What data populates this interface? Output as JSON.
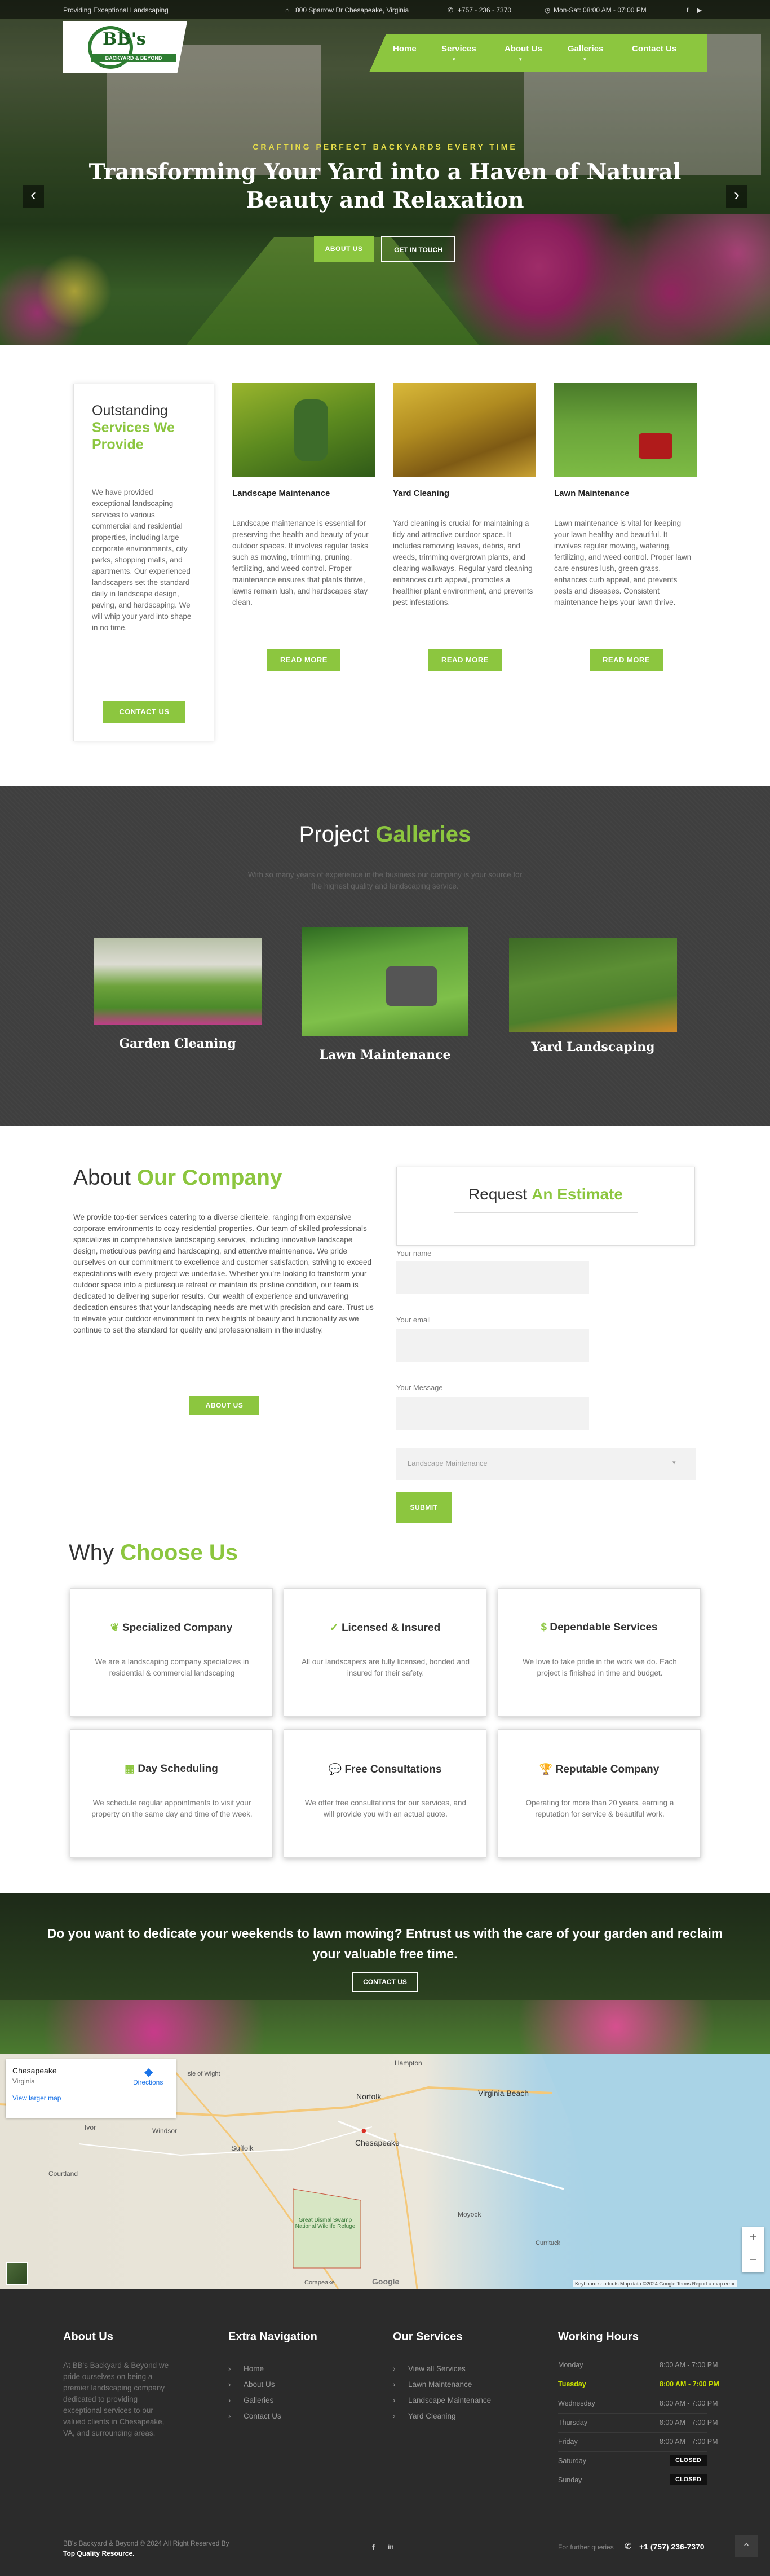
{
  "topbar": {
    "tagline": "Providing Exceptional Landscaping",
    "location": "800 Sparrow Dr Chesapeake, Virginia",
    "phone": "+757 - 236 - 7370",
    "hours": "Mon-Sat: 08:00 AM - 07:00 PM"
  },
  "logo": {
    "text": "BB's",
    "sub": "BACKYARD & BEYOND"
  },
  "nav": [
    "Home",
    "Services",
    "About Us",
    "Galleries",
    "Contact Us"
  ],
  "hero": {
    "kicker": "CRAFTING PERFECT BACKYARDS EVERY TIME",
    "title": "Transforming Your Yard into a Haven of Natural Beauty and Relaxation",
    "btn_about": "ABOUT US",
    "btn_touch": "GET IN TOUCH",
    "prev": "‹",
    "next": "›"
  },
  "services_intro": {
    "title_a": "Outstanding",
    "title_b": "Services We Provide",
    "text": "We have provided exceptional landscaping services to various commercial and residential properties, including large corporate environments, city parks, shopping malls, and apartments. Our experienced landscapers set the standard daily in landscape design, paving, and hardscaping. We will whip your yard into shape in no time.",
    "button": "CONTACT US"
  },
  "services": [
    {
      "title": "Landscape Maintenance",
      "text": "Landscape maintenance is essential for preserving the health and beauty of your outdoor spaces. It involves regular tasks such as mowing, trimming, pruning, fertilizing, and weed control. Proper maintenance ensures that plants thrive, lawns remain lush, and hardscapes stay clean.",
      "button": "READ MORE"
    },
    {
      "title": "Yard Cleaning",
      "text": "Yard cleaning is crucial for maintaining a tidy and attractive outdoor space. It includes removing leaves, debris, and weeds, trimming overgrown plants, and clearing walkways. Regular yard cleaning enhances curb appeal, promotes a healthier plant environment, and prevents pest infestations.",
      "button": "READ MORE"
    },
    {
      "title": "Lawn Maintenance",
      "text": "Lawn maintenance is vital for keeping your lawn healthy and beautiful. It involves regular mowing, watering, fertilizing, and weed control. Proper lawn care ensures lush, green grass, enhances curb appeal, and prevents pests and diseases. Consistent maintenance helps your lawn thrive.",
      "button": "READ MORE"
    }
  ],
  "galleries": {
    "title_a": "Project",
    "title_b": "Galleries",
    "subtitle": "With so many years of experience in the business our company is your source for the highest quality and landscaping service.",
    "items": [
      "Garden Cleaning",
      "Lawn Maintenance",
      "Yard Landscaping"
    ]
  },
  "about": {
    "title_a": "About",
    "title_b": "Our Company",
    "text": "We provide top-tier services catering to a diverse clientele, ranging from expansive corporate environments to cozy residential properties. Our team of skilled professionals specializes in comprehensive landscaping services, including innovative landscape design, meticulous paving and hardscaping, and attentive maintenance. We pride ourselves on our commitment to excellence and customer satisfaction, striving to exceed expectations with every project we undertake. Whether you're looking to transform your outdoor space into a picturesque retreat or maintain its pristine condition, our team is dedicated to delivering superior results. Our wealth of experience and unwavering dedication ensures that your landscaping needs are met with precision and care. Trust us to elevate your outdoor environment to new heights of beauty and functionality as we continue to set the standard for quality and professionalism in the industry.",
    "button": "ABOUT US"
  },
  "estimate": {
    "title_a": "Request",
    "title_b": "An Estimate",
    "name_label": "Your name",
    "email_label": "Your email",
    "message_label": "Your Message",
    "select_value": "Landscape Maintenance",
    "submit": "SUBMIT"
  },
  "why": {
    "title_a": "Why",
    "title_b": "Choose Us",
    "items": [
      {
        "icon": "leaf-icon",
        "glyph": "❦",
        "title": "Specialized Company",
        "text": "We are a landscaping company specializes in residential & commercial landscaping"
      },
      {
        "icon": "check-circle-icon",
        "glyph": "✓",
        "title": "Licensed & Insured",
        "text": "All our landscapers are fully licensed, bonded and insured for their safety."
      },
      {
        "icon": "money-bag-icon",
        "glyph": "$",
        "title": "Dependable Services",
        "text": "We love to take pride in the work we do. Each project is finished in time and budget."
      },
      {
        "icon": "calendar-icon",
        "glyph": "▦",
        "title": "Day Scheduling",
        "text": "We schedule regular appointments to visit your property on the same day and time of the week."
      },
      {
        "icon": "chat-icon",
        "glyph": "💬",
        "title": "Free Consultations",
        "text": "We offer free consultations for our services, and will provide you with an actual quote."
      },
      {
        "icon": "trophy-icon",
        "glyph": "🏆",
        "title": "Reputable Company",
        "text": "Operating for more than 20 years, earning a reputation for service & beautiful work."
      }
    ]
  },
  "cta": {
    "text": "Do you want to dedicate your weekends to lawn mowing? Entrust us with the care of your garden and reclaim your valuable free time.",
    "button": "CONTACT US"
  },
  "map": {
    "place": "Chesapeake",
    "region": "Virginia",
    "directions": "Directions",
    "larger": "View larger map",
    "labels": [
      "Norfolk",
      "Virginia Beach",
      "Chesapeake",
      "Suffolk",
      "Great Dismal Swamp National Wildlife Refuge",
      "Moyock",
      "Courtland",
      "Ivor",
      "Windsor",
      "Hampton",
      "Isle of Wight",
      "Corapeake",
      "Currituck"
    ],
    "footer": "Keyboard shortcuts   Map data ©2024 Google   Terms   Report a map error",
    "google": "Google",
    "zoom_in": "+",
    "zoom_out": "−"
  },
  "footer": {
    "about_title": "About Us",
    "about_text": "At BB's Backyard & Beyond we pride ourselves on being a premier landscaping company dedicated to providing exceptional services to our valued clients in Chesapeake, VA, and surrounding areas.",
    "nav_title": "Extra Navigation",
    "nav": [
      "Home",
      "About Us",
      "Galleries",
      "Contact Us"
    ],
    "svc_title": "Our Services",
    "svc": [
      "View all Services",
      "Lawn Maintenance",
      "Landscape Maintenance",
      "Yard Cleaning"
    ],
    "hours_title": "Working Hours",
    "hours": [
      {
        "day": "Monday",
        "time": "8:00 AM - 7:00 PM",
        "hl": false,
        "closed": false
      },
      {
        "day": "Tuesday",
        "time": "8:00 AM - 7:00 PM",
        "hl": true,
        "closed": false
      },
      {
        "day": "Wednesday",
        "time": "8:00 AM - 7:00 PM",
        "hl": false,
        "closed": false
      },
      {
        "day": "Thursday",
        "time": "8:00 AM - 7:00 PM",
        "hl": false,
        "closed": false
      },
      {
        "day": "Friday",
        "time": "8:00 AM - 7:00 PM",
        "hl": false,
        "closed": false
      },
      {
        "day": "Saturday",
        "time": "CLOSED",
        "hl": false,
        "closed": true
      },
      {
        "day": "Sunday",
        "time": "CLOSED",
        "hl": false,
        "closed": true
      }
    ],
    "copyright": "BB's Backyard & Beyond © 2024 All Right Reserved By",
    "credit": "Top Quality Resource.",
    "queries_label": "For further queries",
    "phone": "+1 (757) 236-7370",
    "facebook": "f",
    "linkedin": "in",
    "top": "⌃"
  },
  "colors": {
    "accent": "#8cc63f",
    "dark": "#3f3f3f",
    "footer": "#2b2b2b"
  }
}
